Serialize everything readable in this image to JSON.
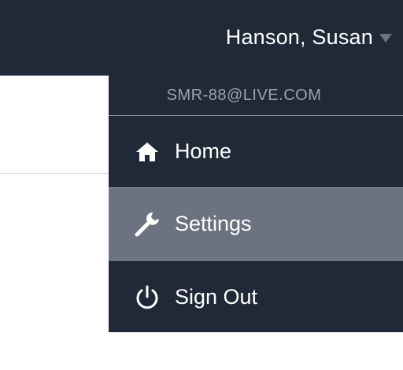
{
  "header": {
    "user_name": "Hanson, Susan",
    "caret_icon": "caret-down-icon"
  },
  "user_menu": {
    "email": "SMR-88@LIVE.COM",
    "items": [
      {
        "label": "Home",
        "icon": "home-icon"
      },
      {
        "label": "Settings",
        "icon": "wrench-icon",
        "active": true
      },
      {
        "label": "Sign Out",
        "icon": "power-icon"
      }
    ]
  },
  "colors": {
    "header_bg": "#1f2937",
    "menu_bg": "#1f2937",
    "active_item_bg": "#6b7280",
    "email_text": "#9ca3af",
    "divider": "#9ca3af"
  }
}
